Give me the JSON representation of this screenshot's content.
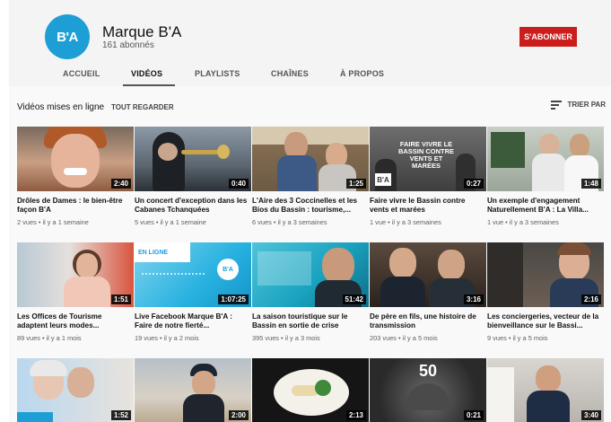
{
  "channel": {
    "logo_text": "B'A",
    "name": "Marque B'A",
    "subscribers": "161 abonnés",
    "subscribe_label": "S'ABONNER",
    "subscribe_color": "#cc1d1d"
  },
  "tabs": [
    {
      "label": "ACCUEIL"
    },
    {
      "label": "VIDÉOS",
      "active": true
    },
    {
      "label": "PLAYLISTS"
    },
    {
      "label": "CHAÎNES"
    },
    {
      "label": "À PROPOS"
    }
  ],
  "section": {
    "title": "Vidéos mises en ligne",
    "see_all": "TOUT REGARDER",
    "sort_label": "TRIER PAR",
    "sort_icon": "sort-icon"
  },
  "videos": [
    {
      "title": "Drôles de Dames : le bien-être façon B'A",
      "meta": "2 vues • il y a 1 semaine",
      "duration": "2:40"
    },
    {
      "title": "Un concert d'exception dans les Cabanes Tchanquées",
      "meta": "5 vues • il y a 1 semaine",
      "duration": "0:40"
    },
    {
      "title": "L'Aire des 3 Coccinelles et les Bios du Bassin : tourisme,...",
      "meta": "6 vues • il y a 3 semaines",
      "duration": "1:25"
    },
    {
      "title": "Faire vivre le Bassin contre vents et marées",
      "meta": "1 vue • il y a 3 semaines",
      "duration": "0:27",
      "overlay": "FAIRE VIVRE LE BASSIN CONTRE VENTS ET MARÉES",
      "overlay2": "B'A"
    },
    {
      "title": "Un exemple d'engagement Naturellement B'A : La Villa...",
      "meta": "1 vue • il y a 3 semaines",
      "duration": "1:48"
    },
    {
      "title": "Les Offices de Tourisme adaptent leurs modes...",
      "meta": "89 vues • il y a 1 mois",
      "duration": "1:51"
    },
    {
      "title": "Live Facebook Marque B'A : Faire de notre fierté...",
      "meta": "19 vues • il y a 2 mois",
      "duration": "1:07:25",
      "overlay": "EN LIGNE",
      "overlay2": "B'A"
    },
    {
      "title": "La saison touristique sur le Bassin en sortie de crise",
      "meta": "395 vues • il y a 3 mois",
      "duration": "51:42"
    },
    {
      "title": "De père en fils, une histoire de transmission",
      "meta": "203 vues • il y a 5 mois",
      "duration": "3:16"
    },
    {
      "title": "Les conciergeries, vecteur de la bienveillance sur le Bassi...",
      "meta": "9 vues • il y a 5 mois",
      "duration": "2:16"
    },
    {
      "title": "",
      "meta": "",
      "duration": "1:52"
    },
    {
      "title": "",
      "meta": "",
      "duration": "2:00"
    },
    {
      "title": "",
      "meta": "",
      "duration": "2:13"
    },
    {
      "title": "",
      "meta": "",
      "duration": "0:21",
      "overlay": "50"
    },
    {
      "title": "",
      "meta": "",
      "duration": "3:40"
    }
  ]
}
